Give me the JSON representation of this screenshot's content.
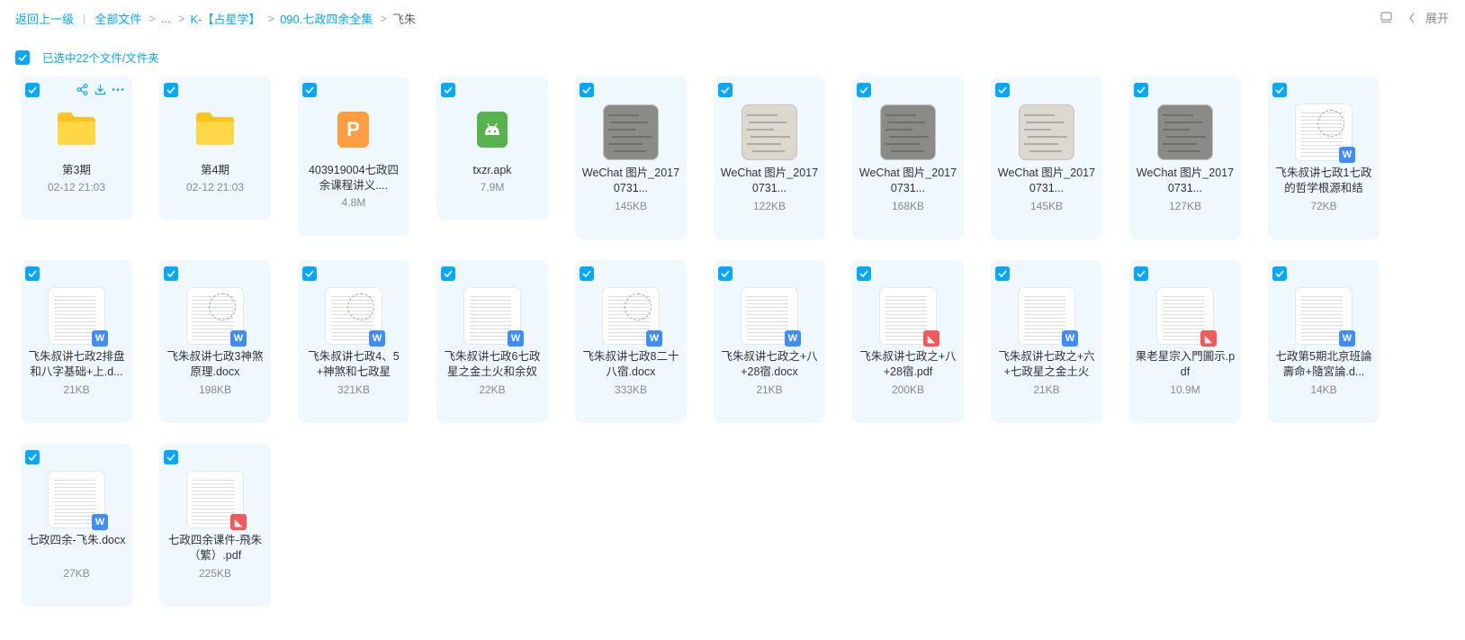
{
  "breadcrumb": {
    "back": "返回上一级",
    "all_files": "全部文件",
    "ellipsis": "...",
    "k_folder": "K-【占星学】",
    "parent_folder": "090.七政四余全集",
    "current": "飞朱"
  },
  "top_right": {
    "expand_label": "展开",
    "icons": [
      "layout-icon",
      "chevron-left-icon"
    ]
  },
  "selection": {
    "text": "已选中22个文件/文件夹"
  },
  "files": [
    {
      "type": "folder",
      "name": "第3期",
      "meta": "02-12 21:03"
    },
    {
      "type": "folder",
      "name": "第4期",
      "meta": "02-12 21:03"
    },
    {
      "type": "ppt",
      "name": "403919004七政四余课程讲义....",
      "meta": "4.8M"
    },
    {
      "type": "apk",
      "name": "txzr.apk",
      "meta": "7.9M"
    },
    {
      "type": "image",
      "name": "WeChat 图片_20170731...",
      "meta": "145KB"
    },
    {
      "type": "image",
      "name": "WeChat 图片_20170731...",
      "meta": "122KB"
    },
    {
      "type": "image",
      "name": "WeChat 图片_20170731...",
      "meta": "168KB"
    },
    {
      "type": "image",
      "name": "WeChat 图片_20170731...",
      "meta": "145KB"
    },
    {
      "type": "image",
      "name": "WeChat 图片_20170731...",
      "meta": "127KB"
    },
    {
      "type": "word",
      "name": "飞朱叔讲七政1七政的哲学根源和结",
      "meta": "72KB"
    },
    {
      "type": "word",
      "name": "飞朱叔讲七政2排盘和八字基础+上.d...",
      "meta": "21KB"
    },
    {
      "type": "word",
      "name": "飞朱叔讲七政3神煞原理.docx",
      "meta": "198KB"
    },
    {
      "type": "word",
      "name": "飞朱叔讲七政4、5+神煞和七政星",
      "meta": "321KB"
    },
    {
      "type": "word",
      "name": "飞朱叔讲七政6七政星之金土火和余奴",
      "meta": "22KB"
    },
    {
      "type": "word",
      "name": "飞朱叔讲七政8二十八宿.docx",
      "meta": "333KB"
    },
    {
      "type": "word",
      "name": "飞朱叔讲七政之+八+28宿.docx",
      "meta": "21KB"
    },
    {
      "type": "pdf",
      "name": "飞朱叔讲七政之+八+28宿.pdf",
      "meta": "200KB"
    },
    {
      "type": "word",
      "name": "飞朱叔讲七政之+六+七政星之金土火",
      "meta": "21KB"
    },
    {
      "type": "pdf",
      "name": "果老星宗入門圖示.pdf",
      "meta": "10.9M"
    },
    {
      "type": "word",
      "name": "七政第5期北京班論壽命+隨宮論.d...",
      "meta": "14KB"
    },
    {
      "type": "word",
      "name": "七政四余-飞朱.docx",
      "meta": "27KB"
    },
    {
      "type": "pdf",
      "name": "七政四余课件-飛朱（繁）.pdf",
      "meta": "225KB"
    }
  ],
  "first_card_actions": [
    "share-icon",
    "download-icon",
    "more-icon"
  ],
  "colors": {
    "accent": "#06a7ff",
    "card_bg": "#eff8ff",
    "word": "#3f8cfd",
    "pdf": "#f35959",
    "ppt": "#ff9d42",
    "apk": "#58b34f",
    "folder": "#ffcc33"
  }
}
